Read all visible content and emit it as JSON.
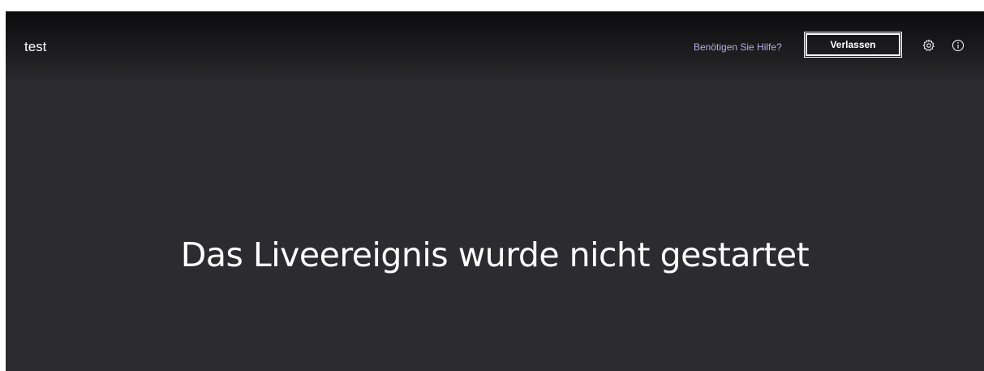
{
  "header": {
    "event_title": "test",
    "help_link": "Benötigen Sie Hilfe?",
    "leave_button": "Verlassen",
    "icons": [
      "gear-icon",
      "info-icon"
    ]
  },
  "main": {
    "status_message": "Das Liveereignis wurde nicht gestartet"
  },
  "colors": {
    "background": "#2c2b30",
    "header_top": "#0c0c0d",
    "help_link": "#b3b0e8",
    "text": "#ffffff"
  }
}
